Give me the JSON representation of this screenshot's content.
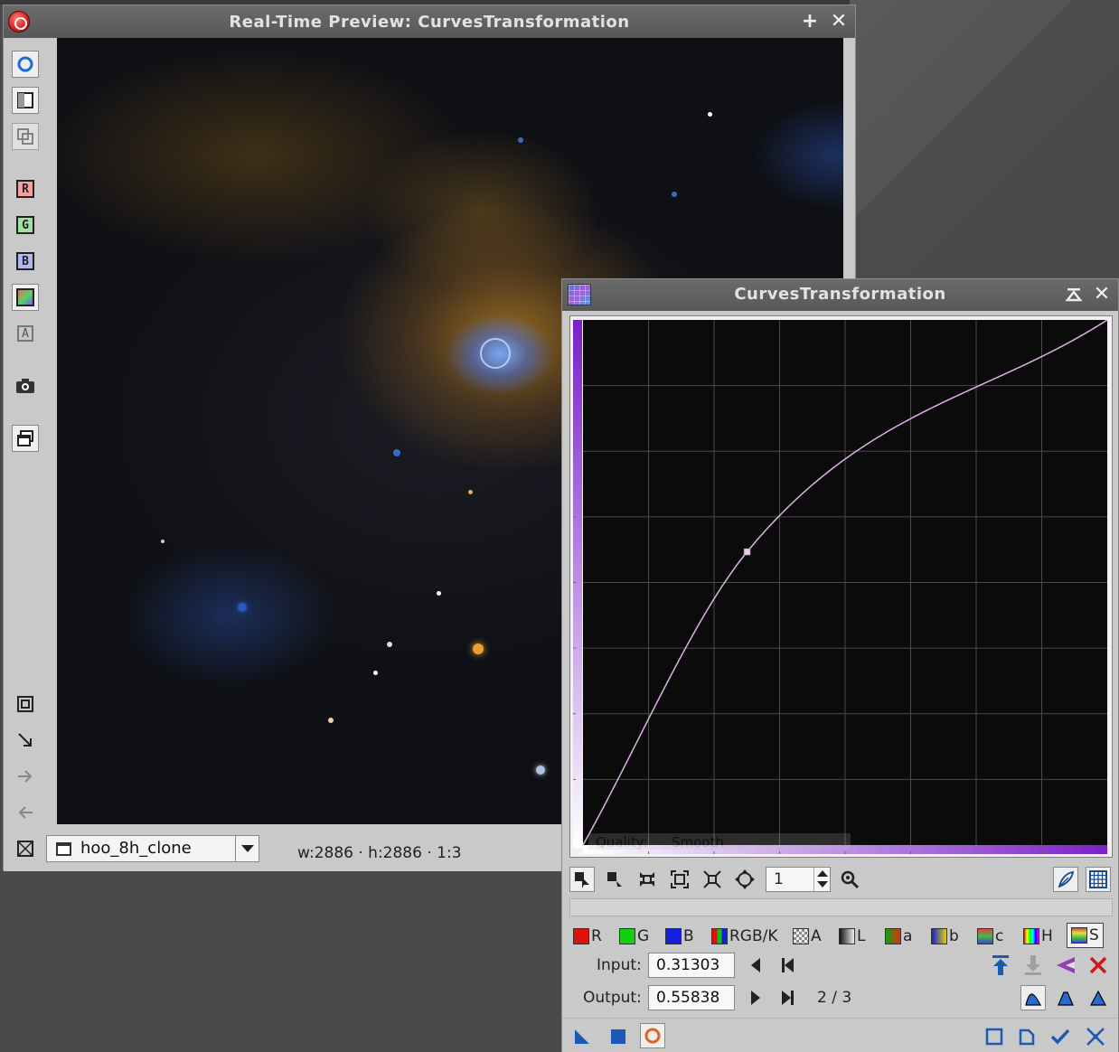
{
  "preview": {
    "title": "Real-Time Preview: CurvesTransformation",
    "toolbar": {
      "channel_r": "R",
      "channel_g": "G",
      "channel_b": "B",
      "channel_a": "A"
    },
    "view_select": "hoo_8h_clone",
    "dims": "w:2886 · h:2886 · 1:3"
  },
  "curves": {
    "title": "CurvesTransformation",
    "zoom": "1",
    "channels": [
      {
        "id": "r",
        "label": "R",
        "color": "#e01010"
      },
      {
        "id": "g",
        "label": "G",
        "color": "#10d010"
      },
      {
        "id": "b",
        "label": "B",
        "color": "#1020e0"
      },
      {
        "id": "rgbk",
        "label": "RGB/K",
        "color": "#b03030"
      },
      {
        "id": "a",
        "label": "A",
        "color": "#aaaaaa"
      },
      {
        "id": "l",
        "label": "L",
        "color": "#444444"
      },
      {
        "id": "a2",
        "label": "a",
        "color": "#8a6020"
      },
      {
        "id": "b2",
        "label": "b",
        "color": "#4040a0"
      },
      {
        "id": "c",
        "label": "c",
        "color": "#50a050"
      },
      {
        "id": "h",
        "label": "H",
        "color": "#d04080"
      },
      {
        "id": "s",
        "label": "S",
        "color": "#6080c0"
      }
    ],
    "selected_channel": "S",
    "input_label": "Input:",
    "input_value": "0.31303",
    "output_label": "Output:",
    "output_value": "0.55838",
    "point_index": "2 / 3",
    "curve": {
      "points": [
        [
          0,
          0
        ],
        [
          0.31303,
          0.55838
        ],
        [
          1,
          1
        ]
      ],
      "curve_color": "#e0b0e8",
      "gradient_color": "#7a20c8"
    },
    "ghost_overlay": {
      "quality_label": "Quality:",
      "quality_value": "Smooth"
    }
  },
  "icons": {
    "preview_close": "close-circle-icon",
    "pin": "plus-icon",
    "close": "close-icon",
    "shade": "shade-icon"
  }
}
